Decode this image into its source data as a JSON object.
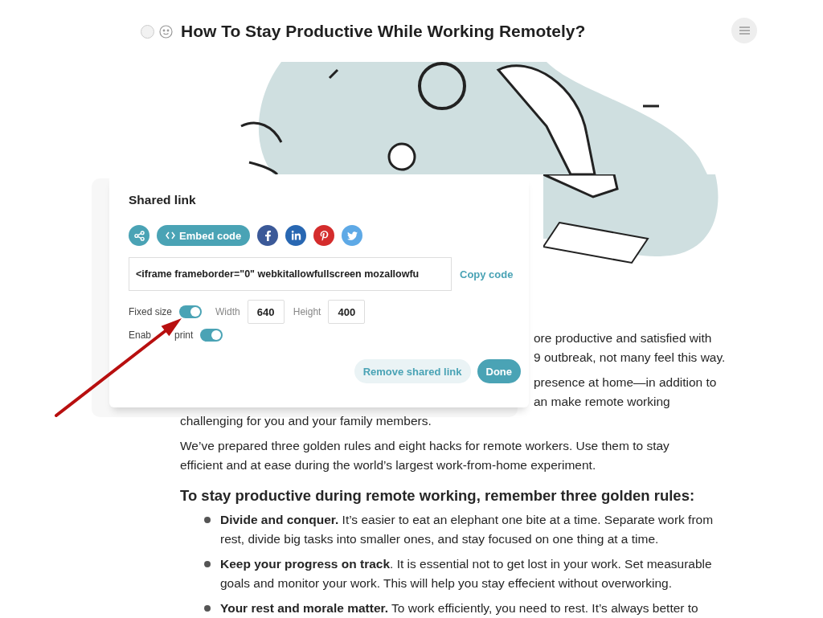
{
  "header": {
    "title": "How To Stay Productive While Working Remotely?"
  },
  "article": {
    "paragraphs": [
      {
        "lines": [
          {
            "text": "ore productive and satisfied with",
            "covered": true
          },
          {
            "text": "9 outbreak, not many feel this way.",
            "covered": true
          }
        ]
      },
      {
        "lines": [
          {
            "text": "presence at home—in addition to",
            "covered": true
          },
          {
            "text": "an make remote working",
            "covered": true
          },
          {
            "text": "challenging for you and your family members.",
            "covered": false
          }
        ]
      },
      {
        "lines": [
          {
            "text": "We’ve prepared three golden rules and eight hacks for remote workers. Use them to stay",
            "covered": false
          },
          {
            "text": "efficient and at ease during the world’s largest work-from-home experiment.",
            "covered": false
          }
        ]
      }
    ],
    "heading": "To stay productive during remote working, remember three golden rules:",
    "bullets": [
      "**Divide and conquer.** It’s easier to eat an elephant one bite at a time. Separate work from rest, divide big tasks into smaller ones, and stay focused on one thing at a time.",
      "**Keep your progress on track**. It is essential not to get lost in your work. Set measurable goals and monitor your work. This will help you stay effecient without overworking.",
      "**Your rest and morale matter.** To work efficiently, you need to rest. It’s always better to"
    ]
  },
  "dialog": {
    "title": "Shared link",
    "share_buttons": [
      {
        "kind": "link"
      },
      {
        "kind": "embed",
        "label": "Embed code"
      },
      {
        "kind": "facebook"
      },
      {
        "kind": "linkedin"
      },
      {
        "kind": "pinterest"
      },
      {
        "kind": "twitter"
      }
    ],
    "code": "<iframe frameborder=\"0\" webkitallowfullscreen mozallowfu",
    "copy": "Copy code",
    "fixed_size": {
      "label": "Fixed size",
      "on": true
    },
    "width": {
      "label": "Width",
      "value": "640"
    },
    "height": {
      "label": "Height",
      "value": "400"
    },
    "enable_print": {
      "label_parts": [
        "Enab",
        "print"
      ],
      "on": true
    },
    "actions": [
      {
        "kind": "secondary",
        "label": "Remove shared link"
      },
      {
        "kind": "primary",
        "label": "Done"
      }
    ]
  }
}
